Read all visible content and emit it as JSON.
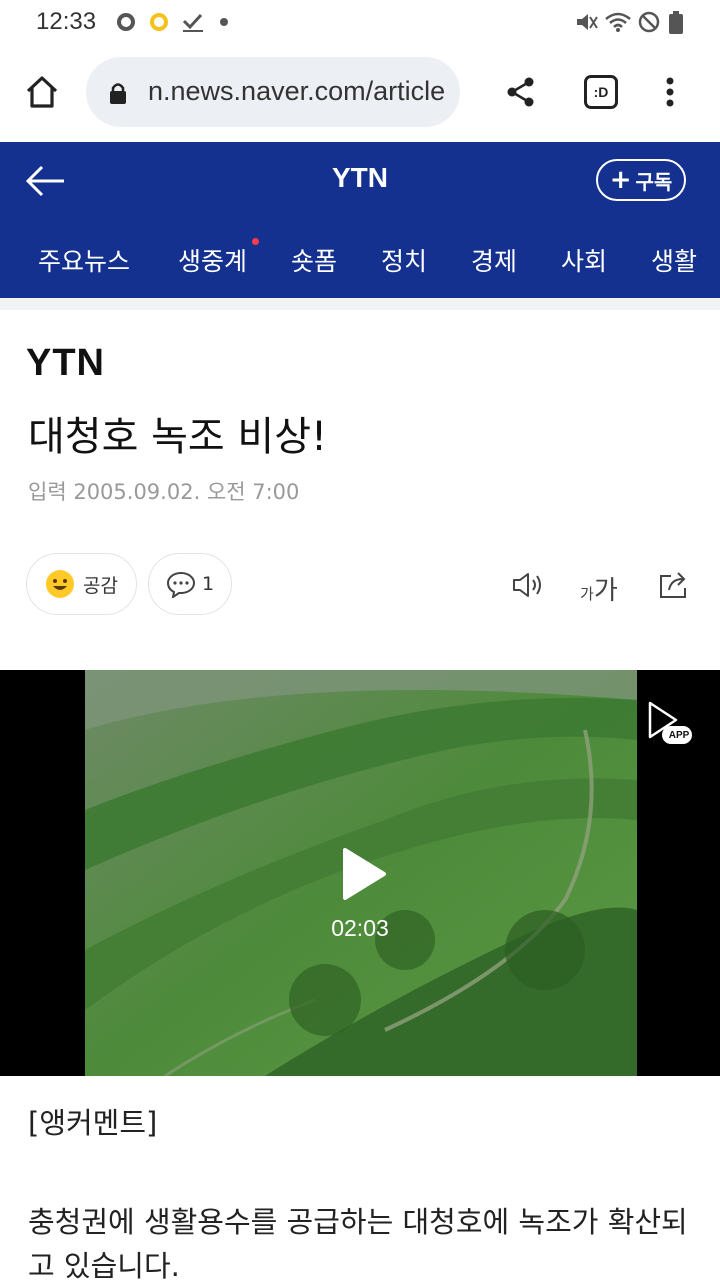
{
  "status_bar": {
    "time": "12:33"
  },
  "browser": {
    "url": "n.news.naver.com/article"
  },
  "header": {
    "brand": "YTN",
    "subscribe_label": "구독",
    "subscribe_plus": "+"
  },
  "tabs": [
    "주요뉴스",
    "생중계",
    "숏폼",
    "정치",
    "경제",
    "사회",
    "생활"
  ],
  "article": {
    "press_logo": "YTN",
    "title": "대청호 녹조 비상!",
    "date_label": "입력",
    "date": "2005.09.02. 오전 7:00",
    "reaction_label": "공감",
    "comment_count": "1",
    "font_size_small": "가",
    "font_size_large": "가"
  },
  "video": {
    "duration": "02:03",
    "app_badge": "APP"
  },
  "body": {
    "anchor_label": "[앵커멘트]",
    "paragraph": "충청권에 생활용수를 공급하는 대청호에 녹조가 확산되고 있습니다."
  },
  "colors": {
    "header_bg": "#14318f",
    "new_dot": "#ff3b4e",
    "urlbar_bg": "#eceff3"
  },
  "icons": [
    "home-icon",
    "lock-icon",
    "share-icon",
    "tab-switcher-icon",
    "more-icon",
    "back-arrow-icon",
    "smile-icon",
    "comment-icon",
    "speaker-icon",
    "external-share-icon",
    "play-icon"
  ]
}
